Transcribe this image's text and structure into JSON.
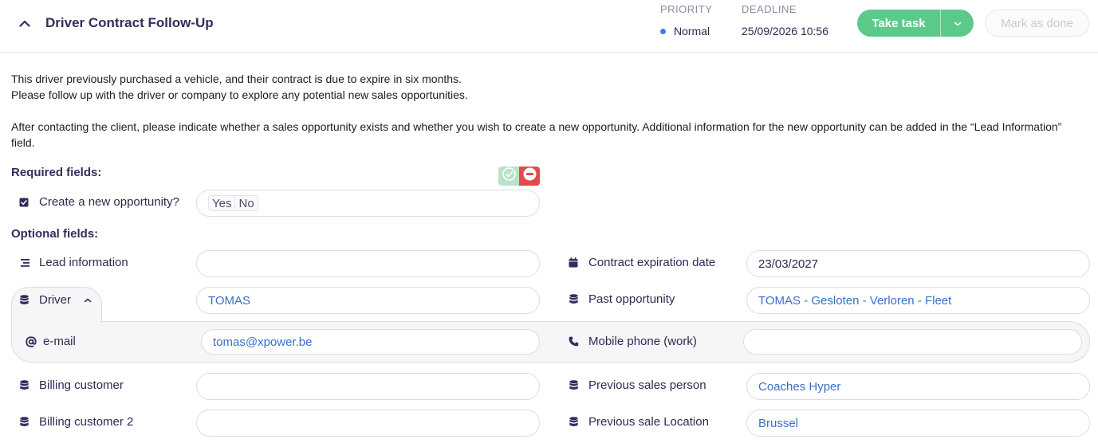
{
  "header": {
    "title": "Driver Contract Follow-Up",
    "priority_label": "PRIORITY",
    "priority_value": "Normal",
    "deadline_label": "DEADLINE",
    "deadline_value": "25/09/2026 10:56",
    "take_task_label": "Take task",
    "mark_done_label": "Mark as done",
    "accent_color": "#5bc98a",
    "priority_dot_color": "#3a7ee8"
  },
  "description": {
    "line1": "This driver previously purchased a vehicle, and their contract is due to expire in six months.",
    "line2": "Please follow up with the driver or company to explore any potential new sales opportunities.",
    "line3": "After contacting the client, please indicate whether a sales opportunity exists and whether you wish to create a new opportunity. Additional information for the new opportunity can be added in the “Lead Information”",
    "line4": "field."
  },
  "required": {
    "title": "Required fields:",
    "create_opportunity_label": "Create a new opportunity?",
    "yes_label": "Yes",
    "no_label": "No"
  },
  "optional": {
    "title": "Optional fields:",
    "lead_information": {
      "label": "Lead information",
      "value": ""
    },
    "contract_expiration": {
      "label": "Contract expiration date",
      "value": "23/03/2027"
    },
    "driver": {
      "label": "Driver",
      "value": "TOMAS"
    },
    "past_opportunity": {
      "label": "Past opportunity",
      "value": "TOMAS - Gesloten - Verloren - Fleet"
    },
    "email": {
      "label": "e-mail",
      "value": "tomas@xpower.be"
    },
    "mobile_phone": {
      "label": "Mobile phone (work)",
      "value": ""
    },
    "billing_customer": {
      "label": "Billing customer",
      "value": ""
    },
    "previous_sales_person": {
      "label": "Previous sales person",
      "value": "Coaches Hyper"
    },
    "billing_customer_2": {
      "label": "Billing customer 2",
      "value": ""
    },
    "previous_sale_location": {
      "label": "Previous sale Location",
      "value": "Brussel"
    }
  },
  "icons": {
    "collapse": "chevron-up-icon",
    "dropdown": "chevron-down-icon",
    "checkbox": "checkbox-checked-icon",
    "lines": "text-lines-icon",
    "calendar": "calendar-icon",
    "database": "database-icon",
    "at": "at-sign-icon",
    "phone": "phone-icon",
    "approve": "check-circle-icon",
    "reject": "minus-circle-icon"
  }
}
